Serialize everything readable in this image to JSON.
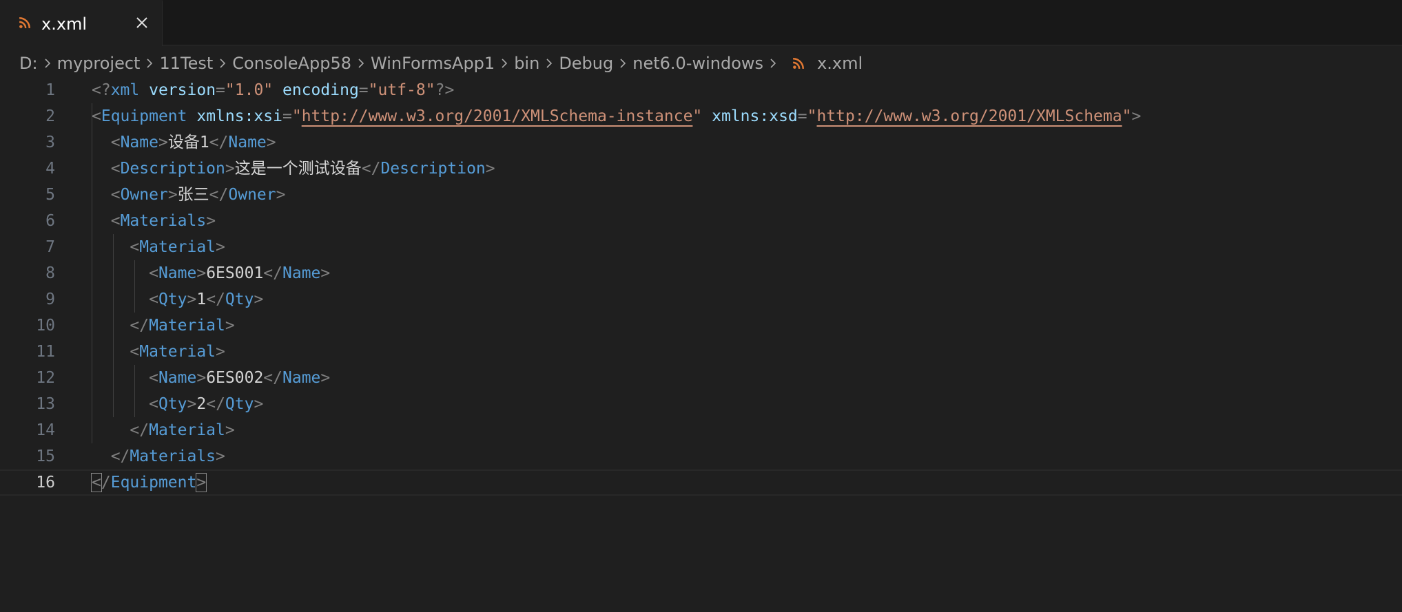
{
  "tab": {
    "label": "x.xml",
    "icon": "rss-icon",
    "close_icon": "close-icon"
  },
  "breadcrumb": {
    "items": [
      "D:",
      "myproject",
      "11Test",
      "ConsoleApp58",
      "WinFormsApp1",
      "bin",
      "Debug",
      "net6.0-windows"
    ],
    "file": "x.xml"
  },
  "colors": {
    "background": "#1f1f1f",
    "tag": "#569cd6",
    "attribute": "#9cdcfe",
    "string": "#ce9178",
    "punctuation": "#808080",
    "text": "#d4d4d4",
    "file_icon": "#e37933"
  },
  "editor": {
    "active_line": 16,
    "lines": [
      {
        "n": "1"
      },
      {
        "n": "2"
      },
      {
        "n": "3"
      },
      {
        "n": "4"
      },
      {
        "n": "5"
      },
      {
        "n": "6"
      },
      {
        "n": "7"
      },
      {
        "n": "8"
      },
      {
        "n": "9"
      },
      {
        "n": "10"
      },
      {
        "n": "11"
      },
      {
        "n": "12"
      },
      {
        "n": "13"
      },
      {
        "n": "14"
      },
      {
        "n": "15"
      },
      {
        "n": "16"
      }
    ],
    "tokens": {
      "l1_open": "<?",
      "l1_tag": "xml",
      "l1_attr1": "version",
      "l1_eq": "=",
      "l1_val1": "\"1.0\"",
      "l1_attr2": "encoding",
      "l1_val2": "\"utf-8\"",
      "l1_close": "?>",
      "l2_tag": "Equipment",
      "l2_attr1": "xmlns:xsi",
      "l2_url1": "http://www.w3.org/2001/XMLSchema-instance",
      "l2_attr2": "xmlns:xsd",
      "l2_url2": "http://www.w3.org/2001/XMLSchema",
      "name_tag": "Name",
      "name_val": "设备1",
      "desc_tag": "Description",
      "desc_val": "这是一个测试设备",
      "owner_tag": "Owner",
      "owner_val": "张三",
      "materials_tag": "Materials",
      "material_tag": "Material",
      "qty_tag": "Qty",
      "m1_name": "6ES001",
      "m1_qty": "1",
      "m2_name": "6ES002",
      "m2_qty": "2"
    }
  }
}
